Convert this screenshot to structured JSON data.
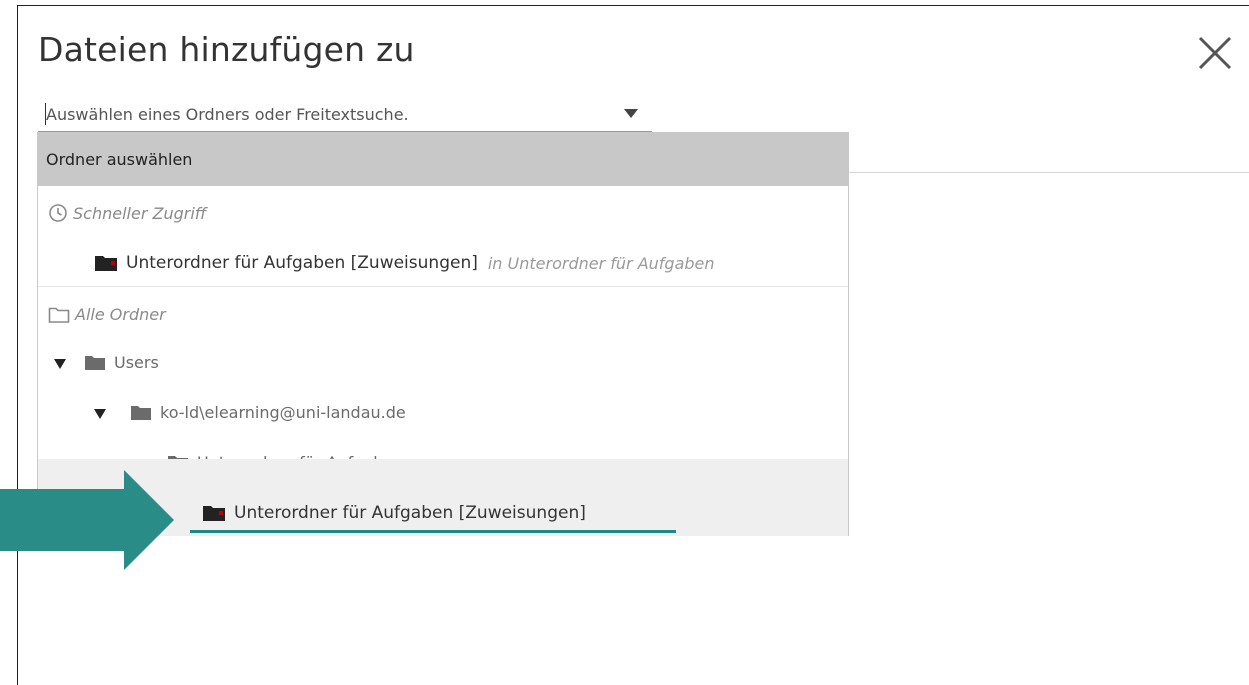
{
  "dialog": {
    "title": "Dateien hinzufügen zu",
    "close_icon": "close-icon"
  },
  "combo": {
    "placeholder": "Auswählen eines Ordners oder Freitextsuche.",
    "value": ""
  },
  "dropdown": {
    "header": "Ordner auswählen",
    "quick_access": {
      "label": "Schneller Zugriff",
      "icon": "clock-icon",
      "items": [
        {
          "label": "Unterordner für Aufgaben [Zuweisungen]",
          "hint": "in Unterordner für Aufgaben"
        }
      ]
    },
    "all_folders": {
      "label": "Alle Ordner",
      "icon": "folder-outline-icon",
      "tree": [
        {
          "label": "Users",
          "expanded": true
        },
        {
          "label": "ko-ld\\elearning@uni-landau.de",
          "expanded": true
        },
        {
          "label": "Unterordner für Aufgaben",
          "expanded": true
        },
        {
          "label": "Unterordner für Aufgaben [Zuweisungen]",
          "selected": true
        }
      ]
    }
  },
  "colors": {
    "accent": "#2a8c87",
    "header_bg": "#c8c8c8",
    "selected_bg": "#efefef"
  }
}
